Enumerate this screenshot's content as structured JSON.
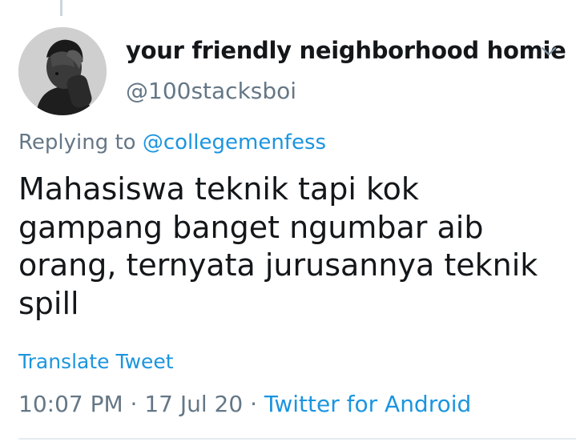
{
  "tweet": {
    "author": {
      "display_name": "your friendly neighborhood homie",
      "handle": "@100stacksboi"
    },
    "reply_prefix": "Replying to ",
    "reply_to": "@collegemenfess",
    "text": "Mahasiswa teknik tapi kok gampang banget ngumbar aib orang, ternyata jurusannya teknik spill",
    "translate_label": "Translate Tweet",
    "time": "10:07 PM",
    "separator": " · ",
    "date": "17 Jul 20",
    "source": "Twitter for Android"
  },
  "icons": {
    "menu": "chevron-down-icon",
    "avatar": "avatar"
  },
  "colors": {
    "link": "#1b95e0",
    "secondary_text": "#657786",
    "primary_text": "#14171a",
    "divider": "#e6ecf0",
    "thread_line": "#ccd6dd"
  }
}
